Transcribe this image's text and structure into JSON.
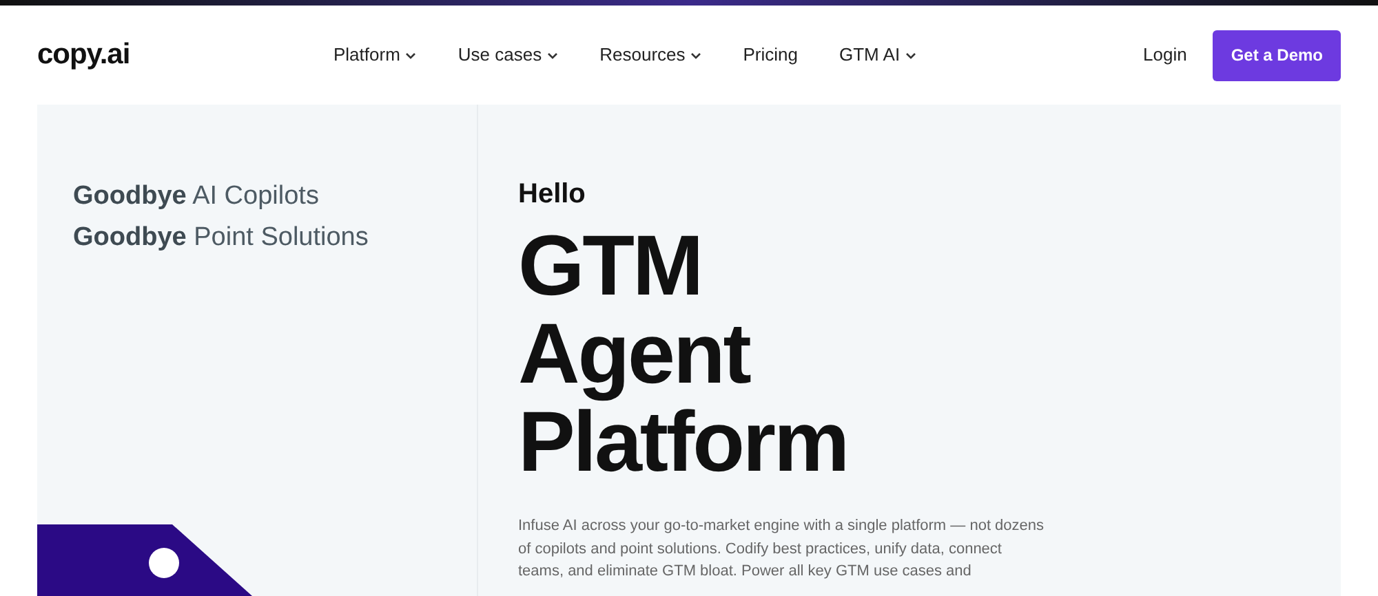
{
  "logo": "copy.ai",
  "nav": [
    {
      "label": "Platform",
      "dropdown": true
    },
    {
      "label": "Use cases",
      "dropdown": true
    },
    {
      "label": "Resources",
      "dropdown": true
    },
    {
      "label": "Pricing",
      "dropdown": false
    },
    {
      "label": "GTM AI",
      "dropdown": true
    }
  ],
  "login": "Login",
  "cta": "Get a Demo",
  "goodbyes": [
    "**Goodbye** AI Copilots",
    "**Goodbye** Point Solutions"
  ],
  "hero": {
    "eyebrow": "Hello",
    "headline": [
      "GTM",
      "Agent",
      "Platform"
    ],
    "body": "Infuse AI across your go-to-market engine with a single platform — not dozens of copilots and point solutions. Codify best practices, unify data, connect teams, and eliminate GTM bloat. Power all key GTM use cases and"
  }
}
